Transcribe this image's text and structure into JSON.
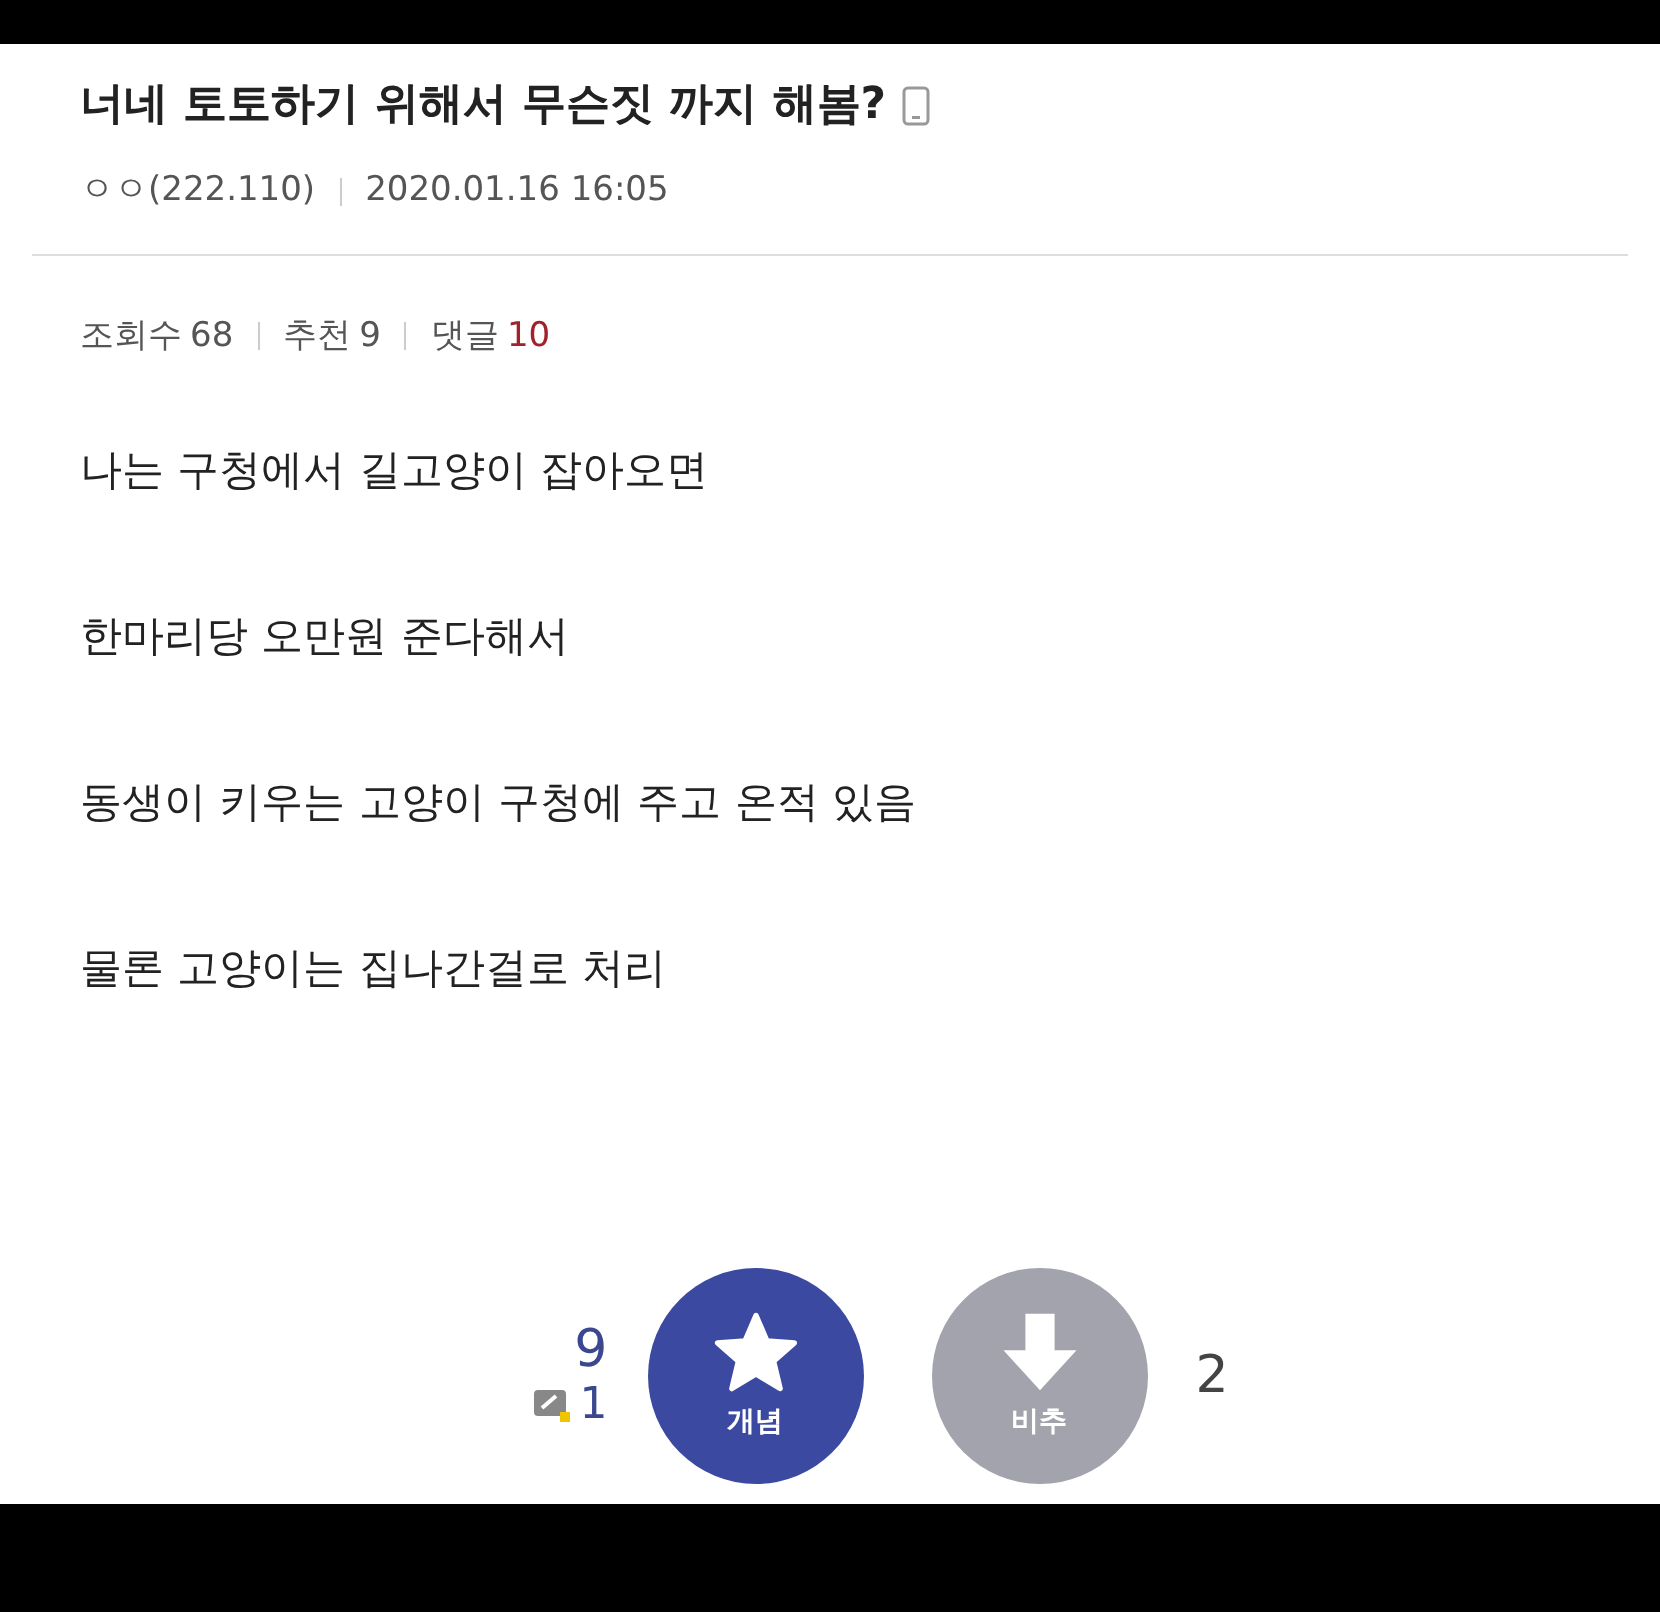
{
  "post": {
    "title": "너네 토토하기 위해서 무슨짓 까지 해봄?",
    "author": "ㅇㅇ(222.110)",
    "date": "2020.01.16 16:05"
  },
  "stats": [
    {
      "label": "조회수",
      "value": "68",
      "kind": "plain"
    },
    {
      "label": "추천",
      "value": "9",
      "kind": "plain"
    },
    {
      "label": "댓글",
      "value": "10",
      "kind": "highlight"
    }
  ],
  "body": [
    "나는 구청에서 길고양이 잡아오면",
    "한마리당 오만원 준다해서",
    "동생이 키우는 고양이 구청에 주고 온적 있음",
    "물론 고양이는 집나간걸로 처리"
  ],
  "votes": {
    "up_count": "9",
    "fixed_count": "1",
    "up_label": "개념",
    "down_label": "비추",
    "down_count": "2"
  }
}
